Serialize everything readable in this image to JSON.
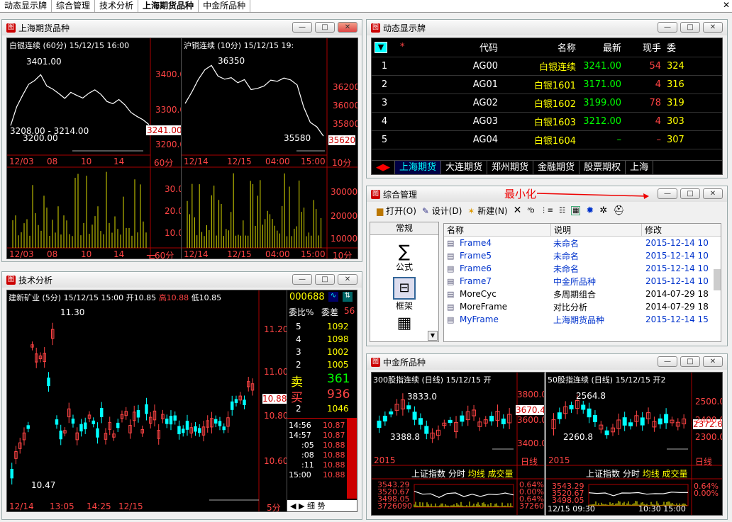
{
  "tabs": [
    "动态显示牌",
    "综合管理",
    "技术分析",
    "上海期货品种",
    "中金所品种"
  ],
  "tab_close": "✕",
  "win_shfe": {
    "title": "上海期货品种"
  },
  "win_dyn": {
    "title": "动态显示牌"
  },
  "win_mgr": {
    "title": "综合管理"
  },
  "win_tech": {
    "title": "技术分析"
  },
  "win_cffex": {
    "title": "中金所品种"
  },
  "wbtn": {
    "min": "—",
    "max": "□",
    "close": "✕"
  },
  "annotation": "最小化",
  "silver": {
    "header": "白银连续 (60分) 15/12/15 16:00",
    "hi": "3401.00",
    "range": "3208.00 - 3214.00",
    "lo": "3200.00",
    "last": "3241.00",
    "ticks": [
      "3400.00",
      "3300.00",
      "3200.00"
    ],
    "x": [
      "12/03",
      "08",
      "10",
      "14"
    ],
    "period": "60分",
    "vticks": [
      "30.0",
      "20.0",
      "10.0"
    ],
    "vunit": "万",
    "vx": [
      "12/03",
      "08",
      "10",
      "14"
    ],
    "vperiod": "60分"
  },
  "copper": {
    "header": "沪铜连续 (10分) 15/12/15 19:",
    "hi": "36350",
    "lo": "35580",
    "last": "35620",
    "ticks": [
      "36200",
      "36000",
      "35800"
    ],
    "x": [
      "12/14",
      "12/15",
      "04:00",
      "15:00"
    ],
    "period": "10分",
    "vticks": [
      "30000",
      "20000",
      "10000"
    ],
    "vx": [
      "12/14",
      "12/15",
      "04:00",
      "15:00"
    ],
    "vperiod": "10分"
  },
  "dyn": {
    "headers": [
      "代码",
      "名称",
      "最新",
      "现手",
      "委"
    ],
    "star": "*",
    "rows": [
      {
        "n": "1",
        "code": "AG00",
        "name": "白银连续",
        "price": "3241.00",
        "vol": "54",
        "x": "324"
      },
      {
        "n": "2",
        "code": "AG01",
        "name": "白银1601",
        "price": "3171.00",
        "vol": "4",
        "x": "316"
      },
      {
        "n": "3",
        "code": "AG02",
        "name": "白银1602",
        "price": "3199.00",
        "vol": "78",
        "x": "319"
      },
      {
        "n": "4",
        "code": "AG03",
        "name": "白银1603",
        "price": "3212.00",
        "vol": "4",
        "x": "303"
      },
      {
        "n": "5",
        "code": "AG04",
        "name": "白银1604",
        "price": "–",
        "vol": "–",
        "x": "307"
      }
    ],
    "tabs": [
      "上海期货",
      "大连期货",
      "郑州期货",
      "金融期货",
      "股票期权",
      "上海"
    ]
  },
  "mgr": {
    "toolbar": [
      "打开(O)",
      "设计(D)",
      "新建(N)"
    ],
    "left_header": "常规",
    "left_items": [
      "公式",
      "框架"
    ],
    "cols": [
      "名称",
      "说明",
      "修改"
    ],
    "rows": [
      {
        "name": "Frame4",
        "desc": "未命名",
        "date": "2015-12-14 10",
        "blue": true
      },
      {
        "name": "Frame5",
        "desc": "未命名",
        "date": "2015-12-14 10",
        "blue": true
      },
      {
        "name": "Frame6",
        "desc": "未命名",
        "date": "2015-12-14 10",
        "blue": true
      },
      {
        "name": "Frame7",
        "desc": "中金所品种",
        "date": "2015-12-14 10",
        "blue": true
      },
      {
        "name": "MoreCyc",
        "desc": "多周期组合",
        "date": "2014-07-29 18",
        "blue": false
      },
      {
        "name": "MoreFrame",
        "desc": "对比分析",
        "date": "2014-07-29 18",
        "blue": false
      },
      {
        "name": "MyFrame",
        "desc": "上海期货品种",
        "date": "2015-12-14 15",
        "blue": true
      }
    ]
  },
  "tech": {
    "header": "建新矿业 (5分) 15/12/15 15:00",
    "open": "开10.85",
    "high": "高10.88",
    "low": "低10.85",
    "hi": "11.30",
    "lo": "10.47",
    "last": "10.88",
    "ticks": [
      "11.20",
      "11.00",
      "10.80",
      "10.60"
    ],
    "x": [
      "12/14",
      "13:05",
      "14:25",
      "12/15",
      "5分"
    ],
    "code": "000688",
    "wb1": "委比%",
    "wb2": "委差",
    "wb2v": "56",
    "sell": [
      [
        "5",
        "1092"
      ],
      [
        "4",
        "1098"
      ],
      [
        "3",
        "1002"
      ],
      [
        "2",
        "1005"
      ]
    ],
    "sell_label": "卖",
    "buy_label": "买",
    "sellv": "361",
    "buyv": "936",
    "b2": [
      "2",
      "1046"
    ],
    "trades": [
      [
        "14:56",
        "10.87"
      ],
      [
        "14:57",
        "10.87"
      ],
      [
        ":05",
        "10.88"
      ],
      [
        ":08",
        "10.88"
      ],
      [
        ":11",
        "10.88"
      ],
      [
        "15:00",
        "10.88"
      ]
    ],
    "foot": [
      "细",
      "势"
    ]
  },
  "hs300": {
    "header": "300股指连续 (日线) 15/12/15 开",
    "hi": "3833.0",
    "lo": "3388.8",
    "last": "3670.4",
    "ticks": [
      "3800.0",
      "3600.0",
      "3400.0"
    ],
    "x": [
      "2015",
      "日线"
    ],
    "sub_title": [
      "上证指数",
      "分时",
      "均线",
      "成交量"
    ],
    "sub_left": [
      "3543.29",
      "3520.67",
      "3498.05",
      "3726090"
    ],
    "sub_right": [
      "0.64%",
      "0.00%",
      "0.64%",
      "3726090"
    ]
  },
  "sz50": {
    "header": "50股指连续 (日线) 15/12/15 开2",
    "hi": "2564.8",
    "lo": "2260.8",
    "last": "2372.6",
    "ticks": [
      "2500.0",
      "2400.0",
      "2300.0"
    ],
    "x": [
      "2015",
      "日线"
    ],
    "sub_title": [
      "上证指数",
      "分时",
      "均线",
      "成交量"
    ],
    "sub_left": [
      "3543.29",
      "3520.67",
      "3498.05"
    ],
    "sub_bot": [
      "12/15 09:30",
      "10:30 15:00"
    ],
    "sub_right": [
      "0.64%",
      "0.00%"
    ]
  }
}
